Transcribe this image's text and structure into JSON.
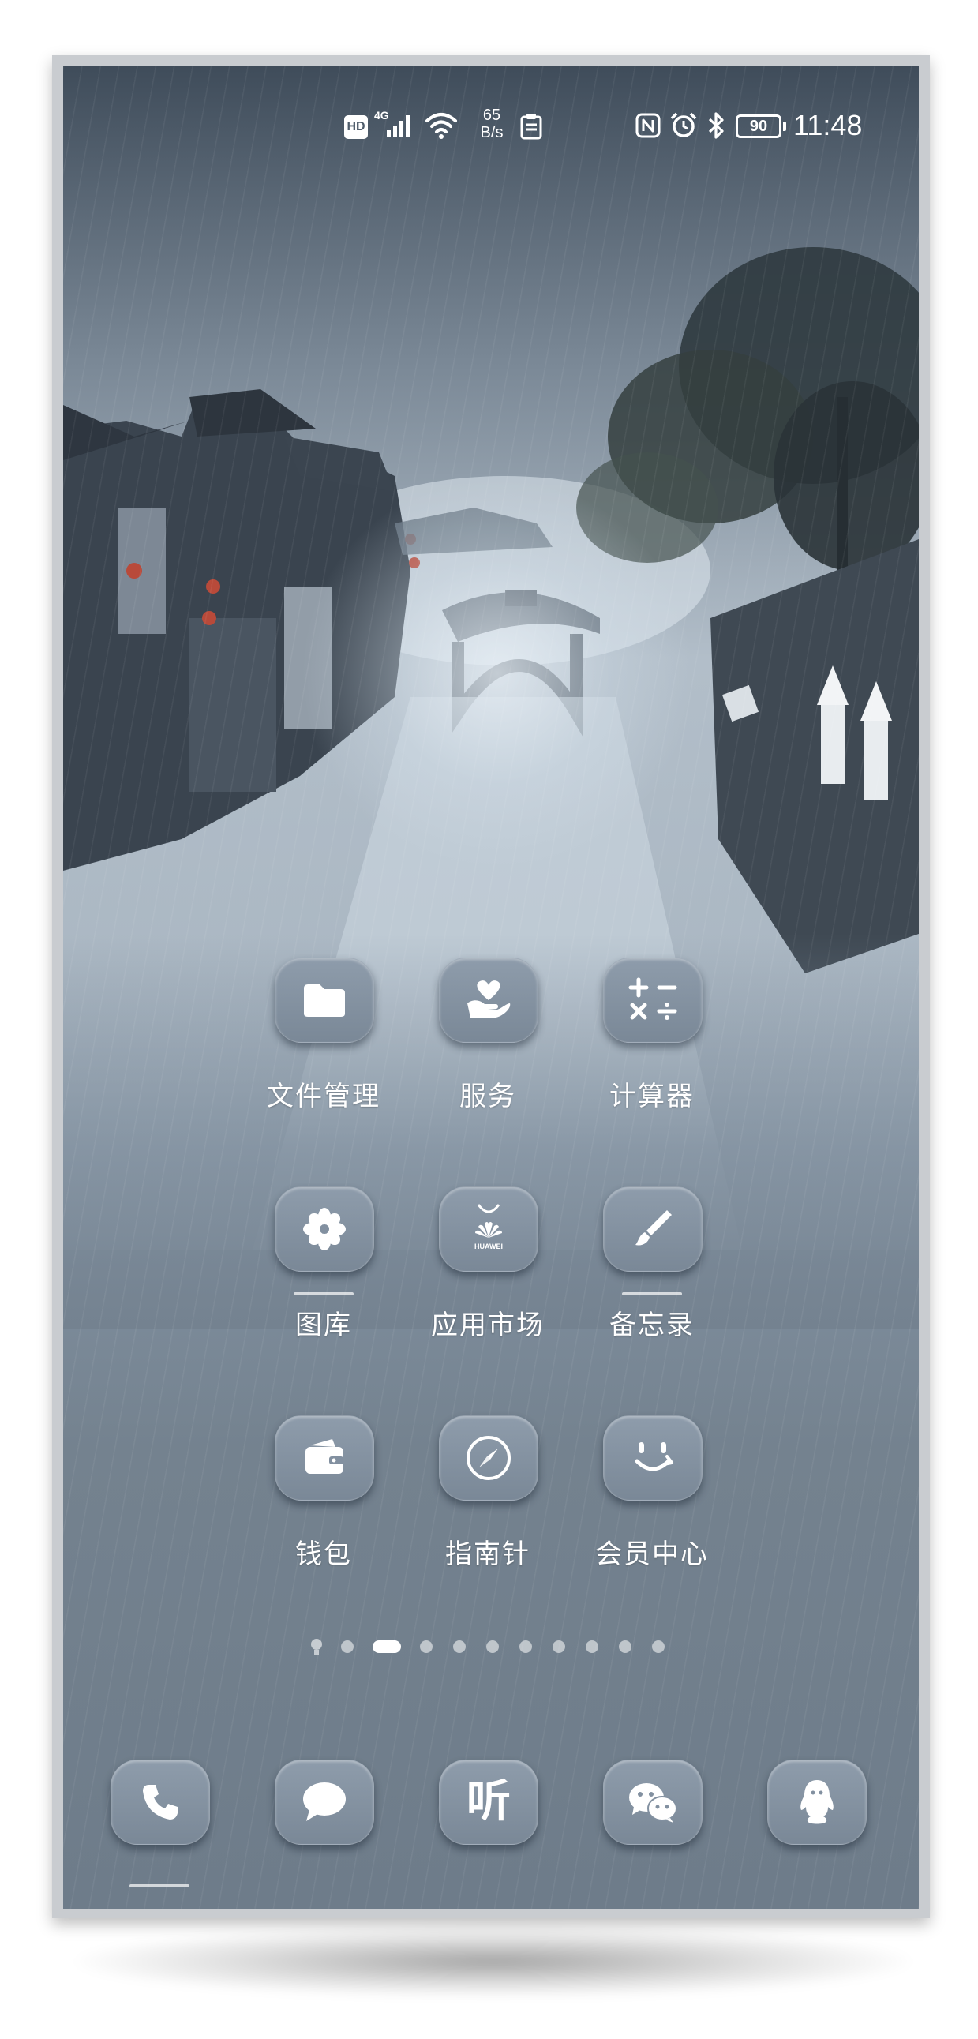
{
  "status_bar": {
    "hd": "HD",
    "network": "4G",
    "speed_value": "65",
    "speed_unit": "B/s",
    "battery": "90",
    "time": "11:48",
    "icons": [
      "hd-icon",
      "signal-icon",
      "wifi-icon",
      "clipboard-icon",
      "nfc-icon",
      "alarm-icon",
      "bluetooth-icon",
      "battery-icon"
    ]
  },
  "apps": [
    {
      "label": "文件管理",
      "icon": "folder-icon"
    },
    {
      "label": "服务",
      "icon": "heart-hand-icon"
    },
    {
      "label": "计算器",
      "icon": "calculator-icon"
    },
    {
      "label": "图库",
      "icon": "flower-icon"
    },
    {
      "label": "应用市场",
      "icon": "huawei-appgallery-icon"
    },
    {
      "label": "备忘录",
      "icon": "brush-icon"
    },
    {
      "label": "钱包",
      "icon": "wallet-icon"
    },
    {
      "label": "指南针",
      "icon": "compass-icon"
    },
    {
      "label": "会员中心",
      "icon": "smile-icon"
    }
  ],
  "huawei_logo_text": "HUAWEI",
  "page_indicator": {
    "total_pages": 10,
    "current_page": 2
  },
  "dock": [
    {
      "name": "phone",
      "icon": "phone-icon"
    },
    {
      "name": "messages",
      "icon": "message-icon"
    },
    {
      "name": "listen",
      "icon": "ting-icon",
      "glyph": "听"
    },
    {
      "name": "wechat",
      "icon": "wechat-icon"
    },
    {
      "name": "qq",
      "icon": "qq-penguin-icon"
    }
  ],
  "colors": {
    "icon_bg": "#8696a5",
    "label": "#ffffff",
    "screen_bottom": "#6e7c8a"
  }
}
